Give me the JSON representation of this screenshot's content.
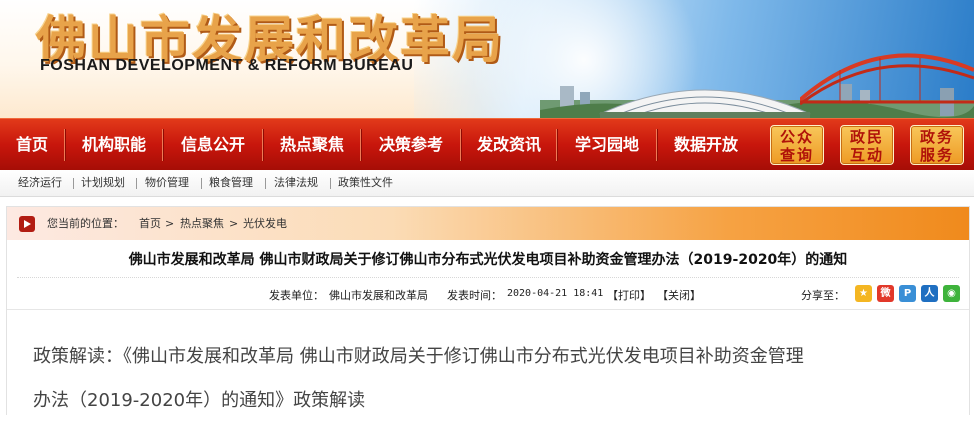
{
  "header": {
    "logo_cn": "佛山市发展和改革局",
    "logo_en": "FOSHAN DEVELOPMENT & REFORM BUREAU"
  },
  "nav": {
    "items": [
      "首页",
      "机构职能",
      "信息公开",
      "热点聚焦",
      "决策参考",
      "发改资讯",
      "学习园地",
      "数据开放"
    ],
    "services": [
      {
        "line1": "公众",
        "line2": "查询"
      },
      {
        "line1": "政民",
        "line2": "互动"
      },
      {
        "line1": "政务",
        "line2": "服务"
      }
    ]
  },
  "subnav": {
    "items": [
      "经济运行",
      "计划规划",
      "物价管理",
      "粮食管理",
      "法律法规",
      "政策性文件"
    ]
  },
  "breadcrumb": {
    "prefix": "您当前的位置：",
    "items": [
      "首页",
      "热点聚焦",
      "光伏发电"
    ],
    "separator": ">"
  },
  "article": {
    "title": "佛山市发展和改革局 佛山市财政局关于修订佛山市分布式光伏发电项目补助资金管理办法（2019-2020年）的通知",
    "publisher_label": "发表单位：",
    "publisher": "佛山市发展和改革局",
    "time_label": "发表时间：",
    "time": "2020-04-21 18:41",
    "print_label": "【打印】",
    "close_label": "【关闭】",
    "share_label": "分享至：",
    "share_icons": [
      "qzone-icon",
      "weibo-icon",
      "pengyou-icon",
      "renren-icon",
      "wechat-icon"
    ],
    "body_line1": "政策解读：《佛山市发展和改革局 佛山市财政局关于修订佛山市分布式光伏发电项目补助资金管理",
    "body_line2": "办法（2019-2020年）的通知》政策解读"
  },
  "colors": {
    "nav_red": "#c8160c",
    "service_orange": "#ee9a25",
    "logo_gold": "#e8a34a"
  }
}
